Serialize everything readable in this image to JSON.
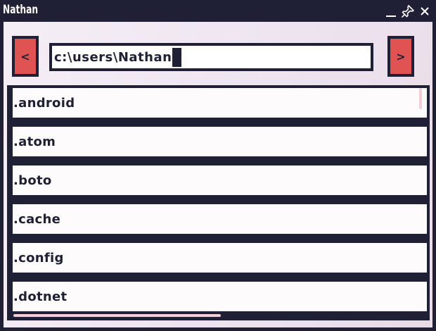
{
  "window": {
    "title": "Nathan",
    "controls": [
      "minimize-icon",
      "pin-icon",
      "close-icon"
    ]
  },
  "nav": {
    "back_label": "<",
    "forward_label": ">"
  },
  "path": {
    "value": "c:\\users\\Nathan"
  },
  "files": [
    ".android",
    ".atom",
    ".boto",
    ".cache",
    ".config",
    ".dotnet"
  ],
  "colors": {
    "frame": "#1f2035",
    "accent": "#e05353",
    "background": "#f4ecf4",
    "scrollbar": "#f4cdd6"
  }
}
